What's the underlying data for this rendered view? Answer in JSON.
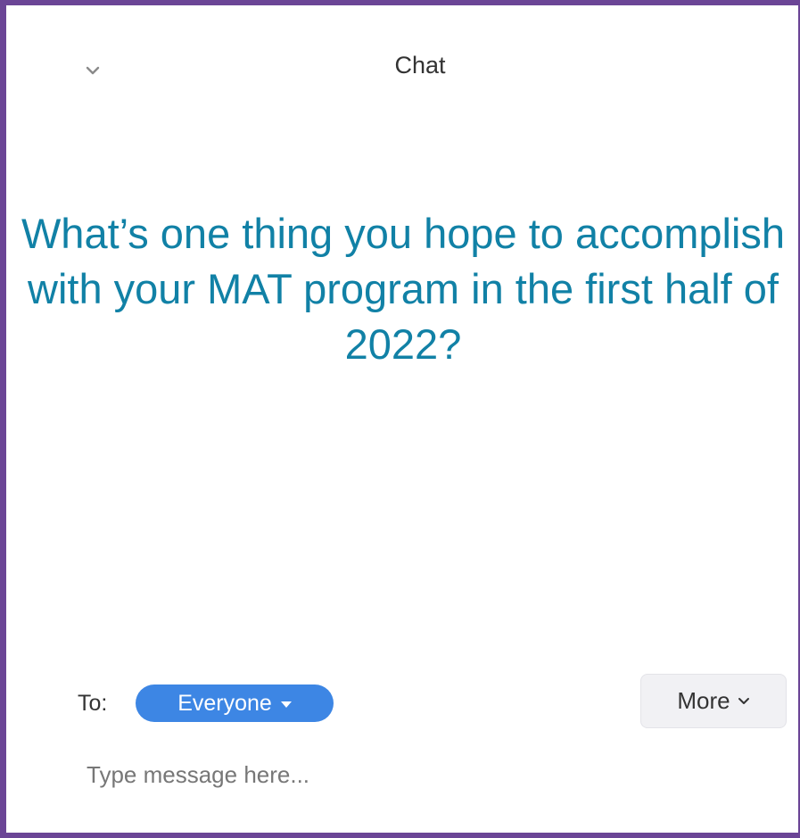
{
  "header": {
    "title": "Chat",
    "collapse_icon": "chevron-down-icon"
  },
  "main": {
    "question": "What’s one thing you hope to accomplish with your MAT program in the first half of 2022?"
  },
  "composer": {
    "to_label": "To:",
    "recipient": "Everyone",
    "recipient_icon": "caret-down-icon",
    "more_label": "More",
    "more_icon": "chevron-down-icon",
    "placeholder": "Type message here..."
  },
  "colors": {
    "border": "#6b4596",
    "question_text": "#1181a6",
    "recipient_pill": "#3d86e4"
  }
}
